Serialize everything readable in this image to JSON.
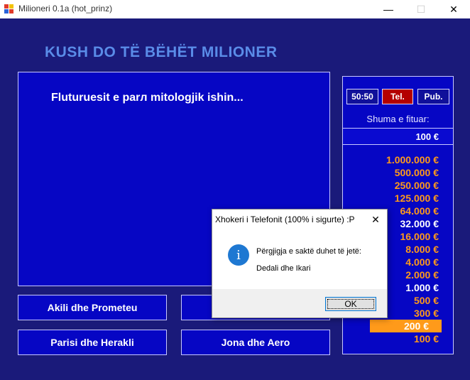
{
  "window": {
    "title": "Milioneri 0.1a (hot_prinz)",
    "min_glyph": "—",
    "max_glyph": "☐",
    "close_glyph": "✕"
  },
  "game": {
    "title": "KUSH DO TË BËHËT MILIONER",
    "question": "Fluturuesit e parл mitologjik ishin...",
    "answers": {
      "a": "Akili dhe Prometeu",
      "b": "",
      "c": "Parisi dhe Herakli",
      "d": "Jona dhe Aero"
    }
  },
  "lifelines": {
    "fifty": "50:50",
    "tel": "Tel.",
    "pub": "Pub."
  },
  "winnings": {
    "label": "Shuma e fituar:",
    "value": "100 €"
  },
  "ladder": [
    {
      "amount": "1.000.000 €",
      "style": "orange"
    },
    {
      "amount": "500.000 €",
      "style": "orange"
    },
    {
      "amount": "250.000 €",
      "style": "orange"
    },
    {
      "amount": "125.000 €",
      "style": "orange"
    },
    {
      "amount": "64.000 €",
      "style": "orange"
    },
    {
      "amount": "32.000 €",
      "style": "white"
    },
    {
      "amount": "16.000 €",
      "style": "orange"
    },
    {
      "amount": "8.000 €",
      "style": "orange"
    },
    {
      "amount": "4.000 €",
      "style": "orange"
    },
    {
      "amount": "2.000 €",
      "style": "orange"
    },
    {
      "amount": "1.000 €",
      "style": "white"
    },
    {
      "amount": "500 €",
      "style": "orange"
    },
    {
      "amount": "300 €",
      "style": "orange"
    },
    {
      "amount": "200 €",
      "style": "current"
    },
    {
      "amount": "100 €",
      "style": "orange"
    }
  ],
  "dialog": {
    "title": "Xhokeri i Telefonit (100% i sigurte) :P",
    "close_glyph": "✕",
    "icon_glyph": "i",
    "line1": "Përgjigja e saktë duhet të jetë:",
    "line2": "Dedali dhe Ikari",
    "ok_label": "OK"
  },
  "colors": {
    "background": "#1a1a7a",
    "panel": "#0606c4",
    "accent_orange": "#ff9a1a",
    "title_blue": "#5a8ce8",
    "tel_red": "#b40000"
  }
}
